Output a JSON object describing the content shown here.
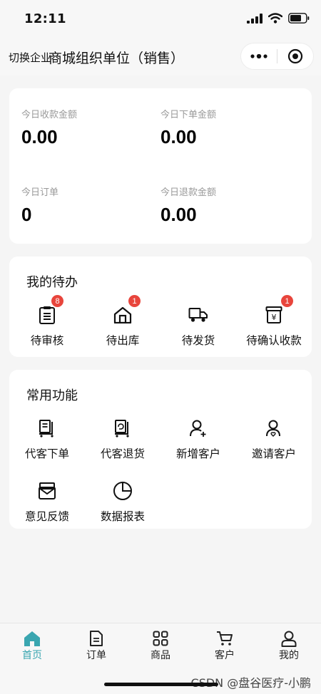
{
  "status_bar": {
    "time": "12:11"
  },
  "nav": {
    "switch_label": "切换企业",
    "title": "商城组织单位（销售）"
  },
  "stats": [
    {
      "label": "今日收款金额",
      "value": "0.00"
    },
    {
      "label": "今日下单金额",
      "value": "0.00"
    },
    {
      "label": "今日订单",
      "value": "0"
    },
    {
      "label": "今日退款金额",
      "value": "0.00"
    }
  ],
  "todo": {
    "title": "我的待办",
    "items": [
      {
        "label": "待审核",
        "badge": "8",
        "icon": "clipboard-list-icon"
      },
      {
        "label": "待出库",
        "badge": "1",
        "icon": "warehouse-icon"
      },
      {
        "label": "待发货",
        "badge": "",
        "icon": "truck-icon"
      },
      {
        "label": "待确认收款",
        "badge": "1",
        "icon": "yen-box-icon"
      }
    ]
  },
  "functions": {
    "title": "常用功能",
    "items": [
      {
        "label": "代客下单",
        "icon": "cart-order-icon"
      },
      {
        "label": "代客退货",
        "icon": "cart-return-icon"
      },
      {
        "label": "新增客户",
        "icon": "user-add-icon"
      },
      {
        "label": "邀请客户",
        "icon": "user-invite-icon"
      },
      {
        "label": "意见反馈",
        "icon": "mail-feedback-icon"
      },
      {
        "label": "数据报表",
        "icon": "pie-chart-icon"
      }
    ]
  },
  "tabs": [
    {
      "label": "首页",
      "icon": "home-icon",
      "active": true
    },
    {
      "label": "订单",
      "icon": "document-icon",
      "active": false
    },
    {
      "label": "商品",
      "icon": "grid-icon",
      "active": false
    },
    {
      "label": "客户",
      "icon": "cart-icon",
      "active": false
    },
    {
      "label": "我的",
      "icon": "user-icon",
      "active": false
    }
  ],
  "colors": {
    "accent": "#3aa6b0",
    "badge": "#e8453c"
  },
  "watermark": "CSDN @盘谷医疗-小鹏"
}
